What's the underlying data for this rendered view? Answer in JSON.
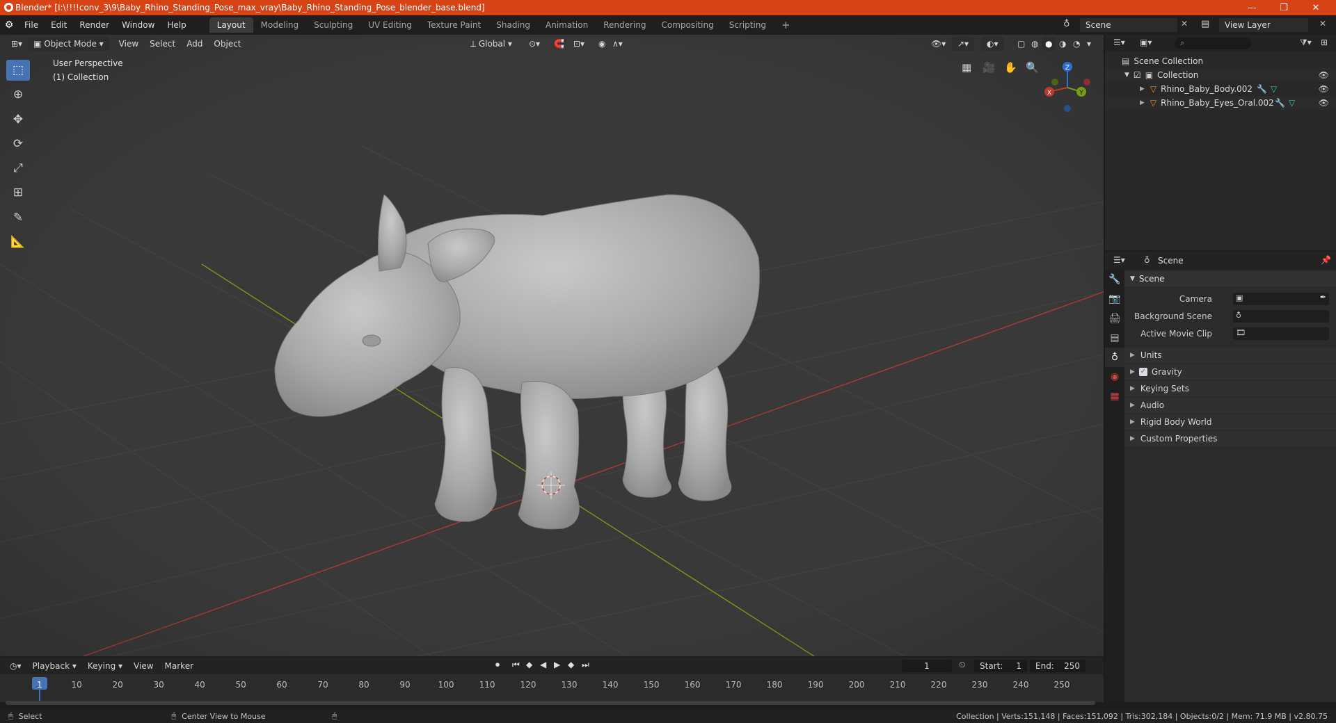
{
  "window": {
    "title": "Blender* [I:\\!!!!conv_3\\9\\Baby_Rhino_Standing_Pose_max_vray\\Baby_Rhino_Standing_Pose_blender_base.blend]",
    "minimize": "—",
    "maximize": "❐",
    "close": "✕"
  },
  "menubar": {
    "menus": [
      "File",
      "Edit",
      "Render",
      "Window",
      "Help"
    ],
    "workspaces": [
      "Layout",
      "Modeling",
      "Sculpting",
      "UV Editing",
      "Texture Paint",
      "Shading",
      "Animation",
      "Rendering",
      "Compositing",
      "Scripting"
    ],
    "add_workspace": "+",
    "scene_name": "Scene",
    "view_layer": "View Layer"
  },
  "viewport": {
    "mode": "Object Mode",
    "menus": [
      "View",
      "Select",
      "Add",
      "Object"
    ],
    "orientation": "Global",
    "perspective_label": "User Perspective",
    "collection_label": "(1) Collection",
    "gizmo": {
      "z": "Z",
      "x": "X",
      "y": "Y"
    }
  },
  "outliner": {
    "root": "Scene Collection",
    "collection": "Collection",
    "objects": [
      "Rhino_Baby_Body.002",
      "Rhino_Baby_Eyes_Oral.002"
    ]
  },
  "properties": {
    "header_title": "Scene",
    "section": "Scene",
    "fields": [
      {
        "label": "Camera"
      },
      {
        "label": "Background Scene"
      },
      {
        "label": "Active Movie Clip"
      }
    ],
    "panels": [
      "Units",
      "Gravity",
      "Keying Sets",
      "Audio",
      "Rigid Body World",
      "Custom Properties"
    ],
    "gravity_enabled": true
  },
  "timeline": {
    "menus": [
      "Playback",
      "Keying",
      "View",
      "Marker"
    ],
    "current_frame": "1",
    "start_label": "Start:",
    "start": "1",
    "end_label": "End:",
    "end": "250",
    "ticks": [
      "1",
      "10",
      "20",
      "30",
      "40",
      "50",
      "60",
      "70",
      "80",
      "90",
      "100",
      "110",
      "120",
      "130",
      "140",
      "150",
      "160",
      "170",
      "180",
      "190",
      "200",
      "210",
      "220",
      "230",
      "240",
      "250"
    ]
  },
  "statusbar": {
    "left_action": "Select",
    "middle_action": "Center View to Mouse",
    "stats": "Collection | Verts:151,148 | Faces:151,092 | Tris:302,184 | Objects:0/2 | Mem: 71.9 MB | v2.80.75"
  },
  "colors": {
    "titlebar": "#d84315",
    "accent": "#4772b3",
    "x_axis": "#c0392b",
    "y_axis": "#7a9a1a",
    "z_axis": "#2f6fcf"
  }
}
